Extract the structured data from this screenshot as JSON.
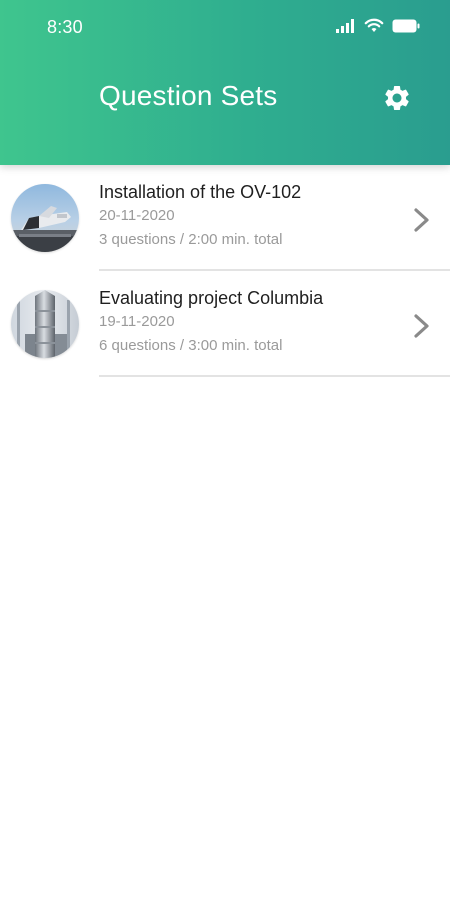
{
  "status_bar": {
    "time": "8:30"
  },
  "header": {
    "title": "Question Sets",
    "settings_icon": "gear-icon"
  },
  "colors": {
    "header_gradient_start": "#3fc58e",
    "header_gradient_end": "#2a9d8f",
    "title_text": "#1f1f1f",
    "secondary_text": "#9a9a9a"
  },
  "question_sets": [
    {
      "title": "Installation of the OV-102",
      "date": "20-11-2020",
      "summary": "3 questions / 2:00 min. total",
      "thumbnail": "space-shuttle-photo"
    },
    {
      "title": "Evaluating project Columbia",
      "date": "19-11-2020",
      "summary": "6 questions / 3:00 min. total",
      "thumbnail": "rocket-hangar-photo"
    }
  ]
}
